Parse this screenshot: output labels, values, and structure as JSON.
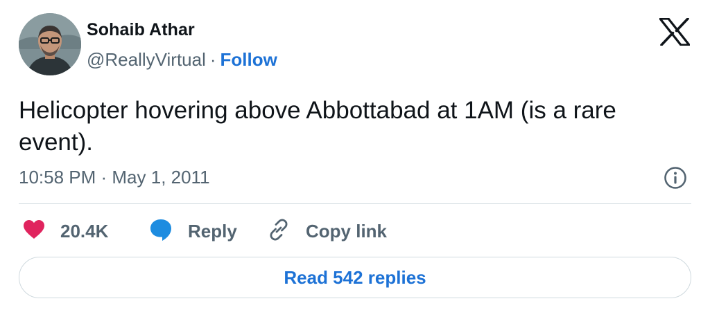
{
  "author": {
    "name": "Sohaib Athar",
    "handle": "@ReallyVirtual",
    "separator": "·",
    "follow_label": "Follow"
  },
  "tweet": {
    "text": "Helicopter hovering above Abbottabad at 1AM (is a rare event).",
    "timestamp": "10:58 PM · May 1, 2011"
  },
  "actions": {
    "likes_count": "20.4K",
    "reply_label": "Reply",
    "copy_link_label": "Copy link"
  },
  "footer": {
    "read_replies_label": "Read 542 replies"
  },
  "icons": {
    "platform": "x-logo-icon",
    "info": "info-icon",
    "like": "heart-icon",
    "reply": "speech-bubble-icon",
    "copy_link": "link-icon"
  },
  "colors": {
    "like": "#e0245e",
    "reply": "#1d8ce0",
    "link_blue": "#1d72d6",
    "secondary_text": "#536471",
    "divider": "#cfd9de"
  }
}
